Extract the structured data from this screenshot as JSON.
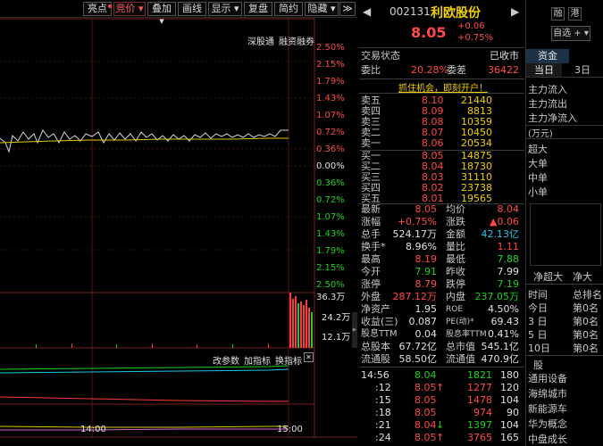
{
  "toolbar": {
    "buttons": [
      "亮点",
      "竞价 ▾",
      "叠加 ▾",
      "画线",
      "显示 ▾",
      "复盘",
      "简约",
      "隐藏 ▾",
      "≫"
    ]
  },
  "chart_header": {
    "shennong": "深股通",
    "rongzi": "融资融券"
  },
  "chart_data": {
    "type": "line",
    "price_axis_labels": [
      "2.50%",
      "2.15%",
      "1.79%",
      "1.43%",
      "1.07%",
      "0.72%",
      "0.36%",
      "0.00%",
      "0.36%",
      "0.72%",
      "1.07%",
      "1.43%",
      "1.79%",
      "2.15%",
      "2.50%"
    ],
    "volume_axis_labels": [
      "36.3万",
      "24.2万",
      "12.1万"
    ],
    "time_labels": [
      "14:00",
      "15:00"
    ],
    "indicator_tabs": [
      "改参数",
      "加指标",
      "换指标"
    ],
    "close_icon": "✕"
  },
  "stock": {
    "code": "002131",
    "name": "利欧股份",
    "price": "8.05",
    "change": "+0.06",
    "change_pct": "+0.75%",
    "badge1": "融",
    "badge2": "港",
    "watch_btn": "自选 + ▾",
    "status_label": "交易状态",
    "status_value": "已收市",
    "weibi_label": "委比",
    "weibi_value": "20.28%",
    "weicha_label": "委差",
    "weicha_value": "36422",
    "promo": "抓住机会，即刻开户！"
  },
  "sell_orders": [
    {
      "label": "卖五",
      "price": "8.10",
      "vol": "21440"
    },
    {
      "label": "卖四",
      "price": "8.09",
      "vol": "8813"
    },
    {
      "label": "卖三",
      "price": "8.08",
      "vol": "10359"
    },
    {
      "label": "卖二",
      "price": "8.07",
      "vol": "10450"
    },
    {
      "label": "卖一",
      "price": "8.06",
      "vol": "20534"
    }
  ],
  "buy_orders": [
    {
      "label": "买一",
      "price": "8.05",
      "vol": "14875"
    },
    {
      "label": "买二",
      "price": "8.04",
      "vol": "18730"
    },
    {
      "label": "买三",
      "price": "8.03",
      "vol": "31110"
    },
    {
      "label": "买四",
      "price": "8.02",
      "vol": "23738"
    },
    {
      "label": "买五",
      "price": "8.01",
      "vol": "19565"
    }
  ],
  "stats": [
    {
      "l1": "最新",
      "v1": "8.05",
      "c1": "red",
      "l2": "均价",
      "v2": "8.04",
      "c2": "red"
    },
    {
      "l1": "涨幅",
      "v1": "+0.75%",
      "c1": "red",
      "l2": "涨跌",
      "v2": "▲0.06",
      "c2": "red"
    },
    {
      "l1": "总手",
      "v1": "524.17万",
      "c1": "wht",
      "l2": "金额",
      "v2": "42.13亿",
      "c2": "cyn"
    },
    {
      "l1": "换手*",
      "v1": "8.96%",
      "c1": "wht",
      "l2": "量比",
      "v2": "1.11",
      "c2": "red"
    },
    {
      "l1": "最高",
      "v1": "8.19",
      "c1": "red",
      "l2": "最低",
      "v2": "7.88",
      "c2": "grn"
    },
    {
      "l1": "今开",
      "v1": "7.91",
      "c1": "grn",
      "l2": "昨收",
      "v2": "7.99",
      "c2": "wht"
    },
    {
      "l1": "涨停",
      "v1": "8.79",
      "c1": "red",
      "l2": "跌停",
      "v2": "7.19",
      "c2": "grn"
    },
    {
      "l1": "外盘",
      "v1": "287.12万",
      "c1": "red",
      "l2": "内盘",
      "v2": "237.05万",
      "c2": "grn"
    },
    {
      "l1": "净资产",
      "v1": "1.95",
      "c1": "wht",
      "l2": "ROE",
      "v2": "4.50%",
      "c2": "wht"
    },
    {
      "l1": "收益(三)",
      "v1": "0.087",
      "c1": "wht",
      "l2": "PE(动)*",
      "v2": "69.43",
      "c2": "wht"
    },
    {
      "l1": "股息TTM",
      "v1": "0.04",
      "c1": "wht",
      "l2": "股息率TTM",
      "v2": "0.41%",
      "c2": "wht"
    },
    {
      "l1": "总股本",
      "v1": "67.72亿",
      "c1": "wht",
      "l2": "总市值",
      "v2": "545.1亿",
      "c2": "wht"
    },
    {
      "l1": "流通股",
      "v1": "58.50亿",
      "c1": "wht",
      "l2": "流通值",
      "v2": "470.9亿",
      "c2": "wht"
    }
  ],
  "ticks": [
    {
      "time": "14:56",
      "price": "8.04",
      "arrow": "",
      "vol": "1821",
      "num": "180",
      "vc": "grn"
    },
    {
      "time": ":12",
      "price": "8.05",
      "arrow": "↑",
      "vol": "1277",
      "num": "120",
      "vc": "red"
    },
    {
      "time": ":15",
      "price": "8.05",
      "arrow": "",
      "vol": "1478",
      "num": "104",
      "vc": "red"
    },
    {
      "time": ":18",
      "price": "8.05",
      "arrow": "",
      "vol": "974",
      "num": "90",
      "vc": "red"
    },
    {
      "time": ":21",
      "price": "8.04",
      "arrow": "↓",
      "vol": "1397",
      "num": "104",
      "vc": "grn"
    },
    {
      "time": ":24",
      "price": "8.05",
      "arrow": "↑",
      "vol": "3765",
      "num": "165",
      "vc": "red"
    }
  ],
  "fund_panel": {
    "tab1": "资金",
    "sub1": "当日",
    "sub2": "3日",
    "flows": [
      "主力流入",
      "主力流出",
      "主力净流入"
    ],
    "unit": "(万元)",
    "sizes": [
      "超大",
      "大单",
      "中单",
      "小单"
    ],
    "net_labels": [
      "净超大",
      "净大"
    ],
    "time_col": "时间",
    "rank_col": "总排名",
    "ranks": [
      {
        "t": "今日",
        "r": "第0名"
      },
      {
        "t": "3 日",
        "r": "第0名"
      },
      {
        "t": "5 日",
        "r": "第0名"
      },
      {
        "t": "10日",
        "r": "第0名"
      }
    ],
    "sector_label": "股",
    "sectors": [
      "通用设备",
      "海绵城市",
      "新能源车",
      "华为概念",
      "中盘成长"
    ]
  }
}
